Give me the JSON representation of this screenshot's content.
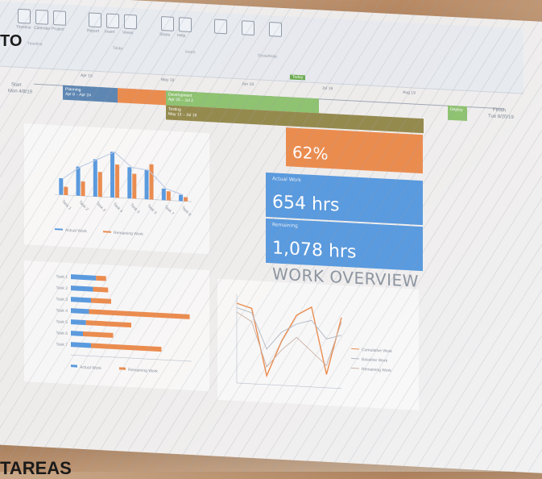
{
  "corner": {
    "top_text": "TO",
    "bottom_text": "TAREAS"
  },
  "ribbon": {
    "buttons": [
      "Timeline",
      "Calendar",
      "Project",
      "Report",
      "Insert",
      "Views",
      "Share",
      "Help"
    ],
    "groups": [
      "Timeline",
      "Tasks",
      "Insert",
      "Show/Hide"
    ]
  },
  "timeline": {
    "today_label": "Today",
    "ticks": [
      "Apr 19",
      "May 19",
      "Jun 19",
      "Jul 19",
      "Aug 19"
    ],
    "start_label": "Start",
    "finish_label": "Finish",
    "start_date": "Mon 4/8/19",
    "finish_date": "Tue 8/20/19",
    "tasks": [
      {
        "name": "Planning",
        "dates": "Apr 8 – Apr 24"
      },
      {
        "name": "Development",
        "dates": "Apr 25 – Jul 2"
      },
      {
        "name": "Testing",
        "dates": "May 13 – Jul 19"
      },
      {
        "name": "Deploy",
        "dates": "Aug 2"
      }
    ]
  },
  "work_overview": {
    "title": "WORK OVERVIEW",
    "percent": "62%",
    "actual_label": "Actual Work",
    "actual": "654 hrs",
    "remaining_label": "Remaining",
    "remaining": "1,078 hrs"
  },
  "colors": {
    "orange": "#eb8c4f",
    "blue": "#5a9ade",
    "green": "#8fc271",
    "olive": "#958a4e",
    "teal": "#4f8fb3"
  },
  "chart_data": [
    {
      "type": "bar",
      "title": "",
      "categories": [
        "Task 1",
        "Task 2",
        "Task 3",
        "Task 4",
        "Task 5",
        "Task 6",
        "Task 7",
        "Task 8"
      ],
      "series": [
        {
          "name": "Actual Work",
          "values": [
            40,
            70,
            90,
            110,
            75,
            70,
            28,
            15
          ]
        },
        {
          "name": "Remaining Work",
          "values": [
            20,
            35,
            60,
            80,
            60,
            85,
            22,
            10
          ]
        }
      ],
      "ylim": [
        0,
        140
      ],
      "legend": "bottom"
    },
    {
      "type": "bar",
      "title": "",
      "categories": [
        "Task 1",
        "Task 2",
        "Task 3",
        "Task 4",
        "Task 5",
        "Task 6",
        "Task 7"
      ],
      "series": [
        {
          "name": "Actual Work",
          "values": [
            25,
            22,
            20,
            18,
            15,
            12,
            20
          ]
        },
        {
          "name": "Remaining Work",
          "values": [
            10,
            15,
            20,
            100,
            45,
            30,
            70
          ]
        }
      ],
      "xlim": [
        0,
        120
      ],
      "legend": "bottom"
    },
    {
      "type": "line",
      "title": "",
      "x": [
        1,
        2,
        3,
        4,
        5,
        6,
        7,
        8
      ],
      "series": [
        {
          "name": "Cumulative Work",
          "values": [
            90,
            85,
            10,
            50,
            80,
            90,
            15,
            80
          ]
        },
        {
          "name": "Baseline Work",
          "values": [
            85,
            80,
            40,
            60,
            70,
            75,
            55,
            60
          ]
        },
        {
          "name": "Remaining Work",
          "values": [
            80,
            70,
            20,
            40,
            55,
            40,
            25,
            75
          ]
        }
      ],
      "ylim": [
        0,
        100
      ],
      "legend": "right"
    }
  ]
}
